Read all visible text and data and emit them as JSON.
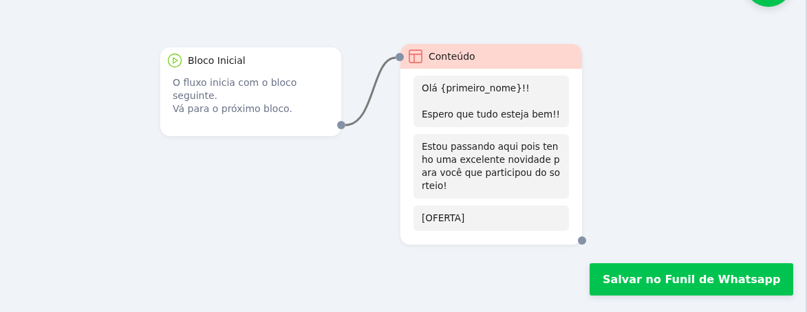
{
  "nodes": [
    {
      "kind": "start",
      "title": "Bloco Inicial",
      "description": [
        "O fluxo inicia com o bloco seguinte.",
        "Vá para o próximo bloco."
      ]
    },
    {
      "kind": "content",
      "title": "Conteúdo",
      "messages": [
        "Olá {primeiro_nome}!!\n\nEspero que tudo esteja bem!!",
        "Estou passando aqui pois tenho uma excelente novidade para você que participou do sorteio!",
        "[OFERTA]"
      ]
    }
  ],
  "save_button": "Salvar no Funil de Whatsapp"
}
